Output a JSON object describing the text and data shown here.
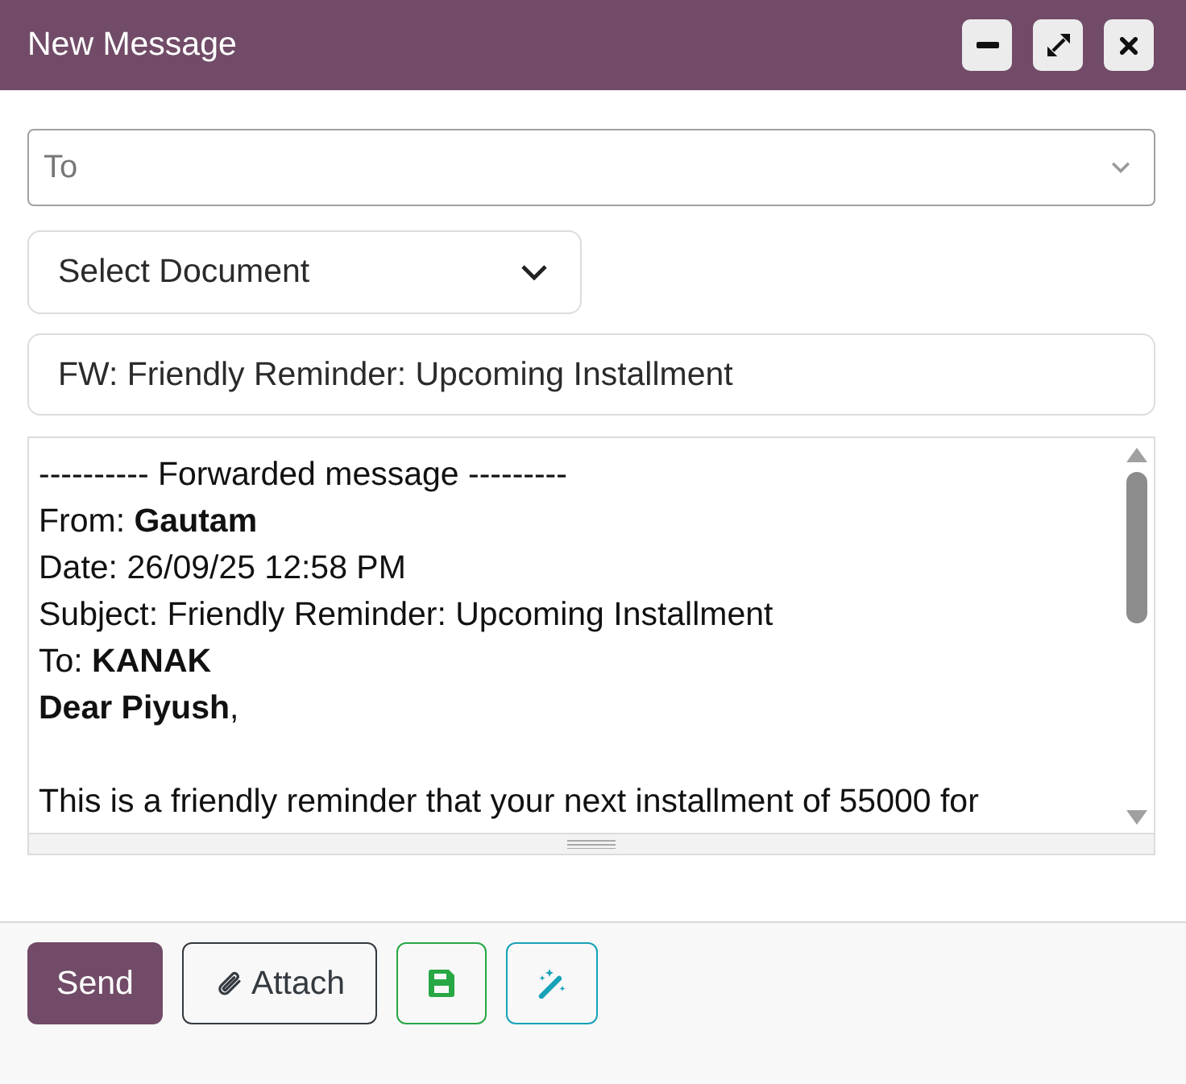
{
  "window": {
    "title": "New Message"
  },
  "to_field": {
    "placeholder": "To"
  },
  "document_select": {
    "value": "Select Document"
  },
  "subject_field": {
    "value": "FW: Friendly Reminder: Upcoming Installment"
  },
  "editor": {
    "lines": [
      {
        "kind": "line",
        "text": "---------- Forwarded message ---------"
      },
      {
        "kind": "line",
        "text": "From: **Gautam**"
      },
      {
        "kind": "line",
        "text": "Date: 26/09/25 12:58 PM"
      },
      {
        "kind": "line",
        "text": "Subject: Friendly Reminder: Upcoming Installment"
      },
      {
        "kind": "line",
        "text": "To: **KANAK**"
      },
      {
        "kind": "line",
        "text": "**Dear Piyush**,"
      },
      {
        "kind": "paragraph",
        "text": "This is a friendly reminder that your next installment of 55000 for"
      }
    ]
  },
  "buttons": [
    {
      "kind": "primary",
      "label": "Send"
    },
    {
      "kind": "attach",
      "label": "Attach"
    },
    {
      "kind": "save"
    },
    {
      "kind": "magic"
    }
  ]
}
